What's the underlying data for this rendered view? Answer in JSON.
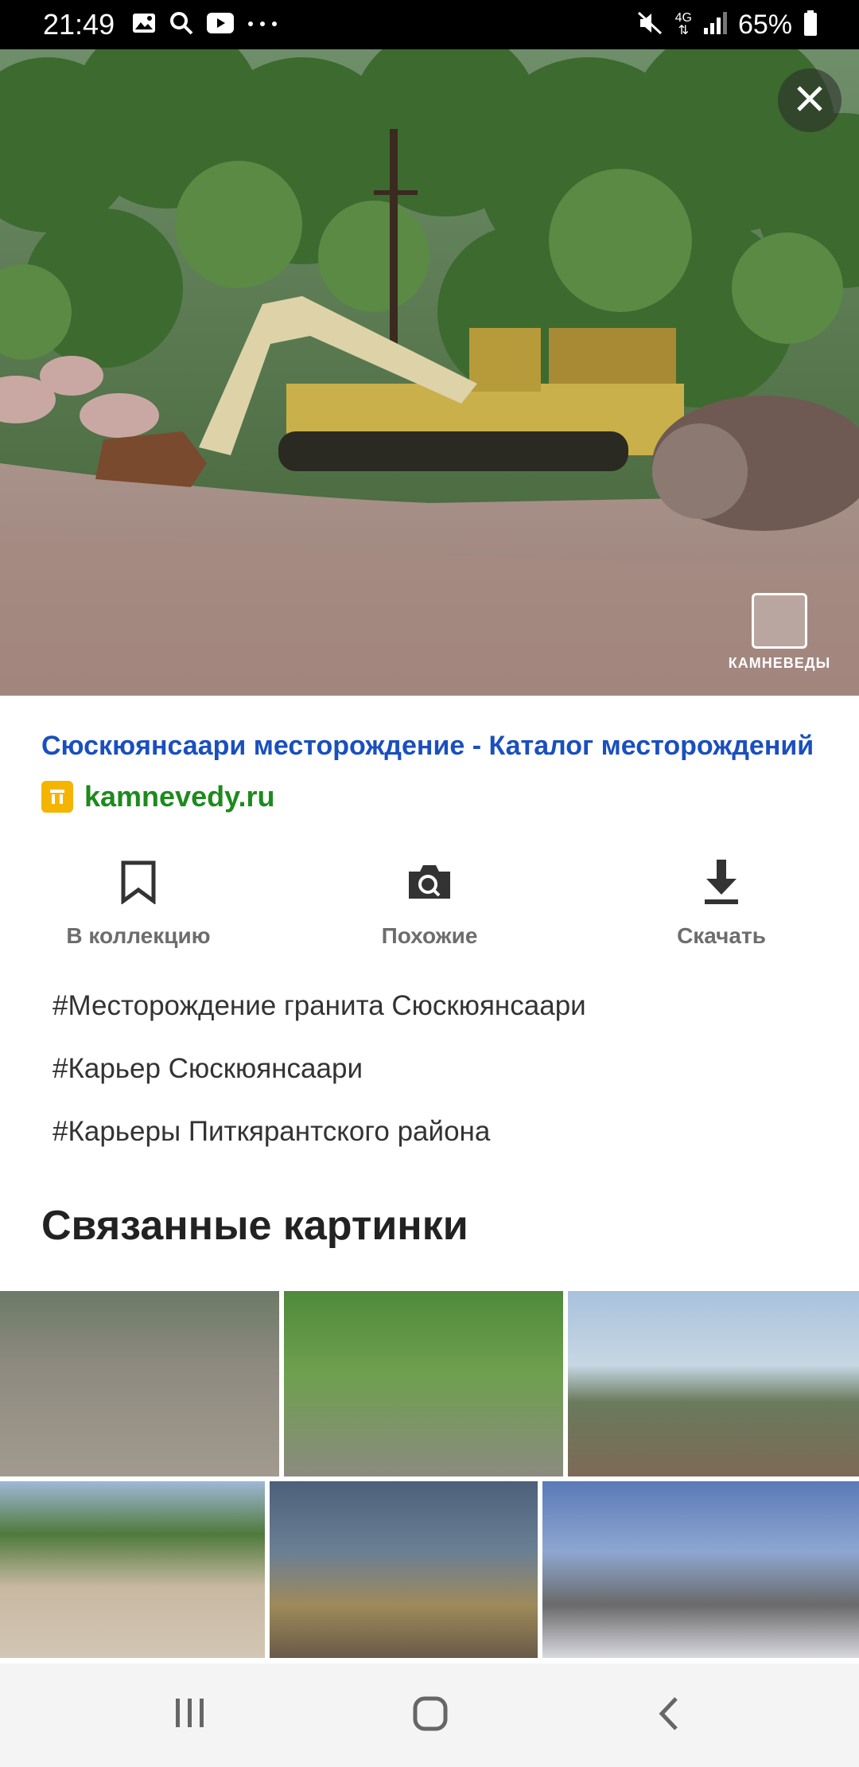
{
  "status_bar": {
    "time": "21:49",
    "battery": "65%",
    "network": "4G",
    "icons": [
      "image-icon",
      "search-icon",
      "youtube-icon",
      "more-icon",
      "mute-icon",
      "signal-icon",
      "battery-icon"
    ]
  },
  "viewer": {
    "close_icon": "close-icon",
    "watermark": "КАМНЕВЕДЫ"
  },
  "result": {
    "title": "Сюскюянсаари месторождение - Каталог месторождений",
    "domain": "kamnevedy.ru"
  },
  "actions": [
    {
      "label": "В коллекцию",
      "icon": "bookmark-icon"
    },
    {
      "label": "Похожие",
      "icon": "camera-search-icon"
    },
    {
      "label": "Скачать",
      "icon": "download-icon"
    }
  ],
  "tags": [
    "#Месторождение гранита Сюскюянсаари",
    "#Карьер Сюскюянсаари",
    "#Карьеры Питкярантского района"
  ],
  "related": {
    "title": "Связанные картинки"
  },
  "nav": {
    "icons": [
      "recent-apps-icon",
      "home-icon",
      "back-icon"
    ]
  },
  "colors": {
    "title": "#1a4fbf",
    "domain": "#1e8a1e",
    "favicon": "#f5b400"
  }
}
